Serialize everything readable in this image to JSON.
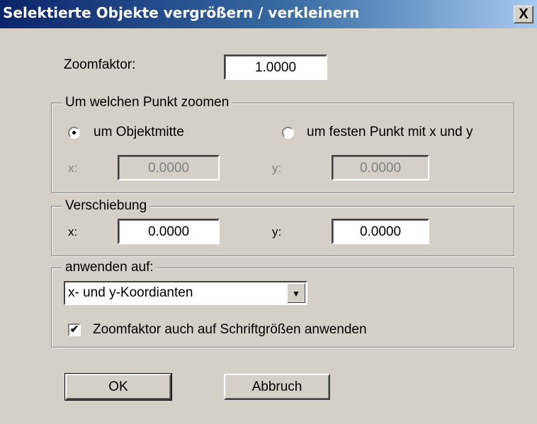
{
  "window": {
    "title": "Selektierte Objekte vergrößern / verkleinern",
    "close_glyph": "X"
  },
  "zoom": {
    "label": "Zoomfaktor:",
    "value": "1.0000"
  },
  "zoom_point": {
    "caption": "Um welchen Punkt zoomen",
    "option_center": "um Objektmitte",
    "option_fixed": "um festen Punkt mit x und y",
    "selected": "center",
    "x_label": "x:",
    "x_value": "0.0000",
    "y_label": "y:",
    "y_value": "0.0000"
  },
  "offset": {
    "caption": "Verschiebung",
    "x_label": "x:",
    "x_value": "0.0000",
    "y_label": "y:",
    "y_value": "0.0000"
  },
  "apply": {
    "caption": "anwenden auf:",
    "selected": "x- und y-Koordianten",
    "checkbox_label": "Zoomfaktor auch auf Schriftgrößen anwenden",
    "checkbox_checked": true,
    "check_glyph": "✔",
    "arrow_glyph": "▼"
  },
  "buttons": {
    "ok": "OK",
    "cancel": "Abbruch"
  }
}
